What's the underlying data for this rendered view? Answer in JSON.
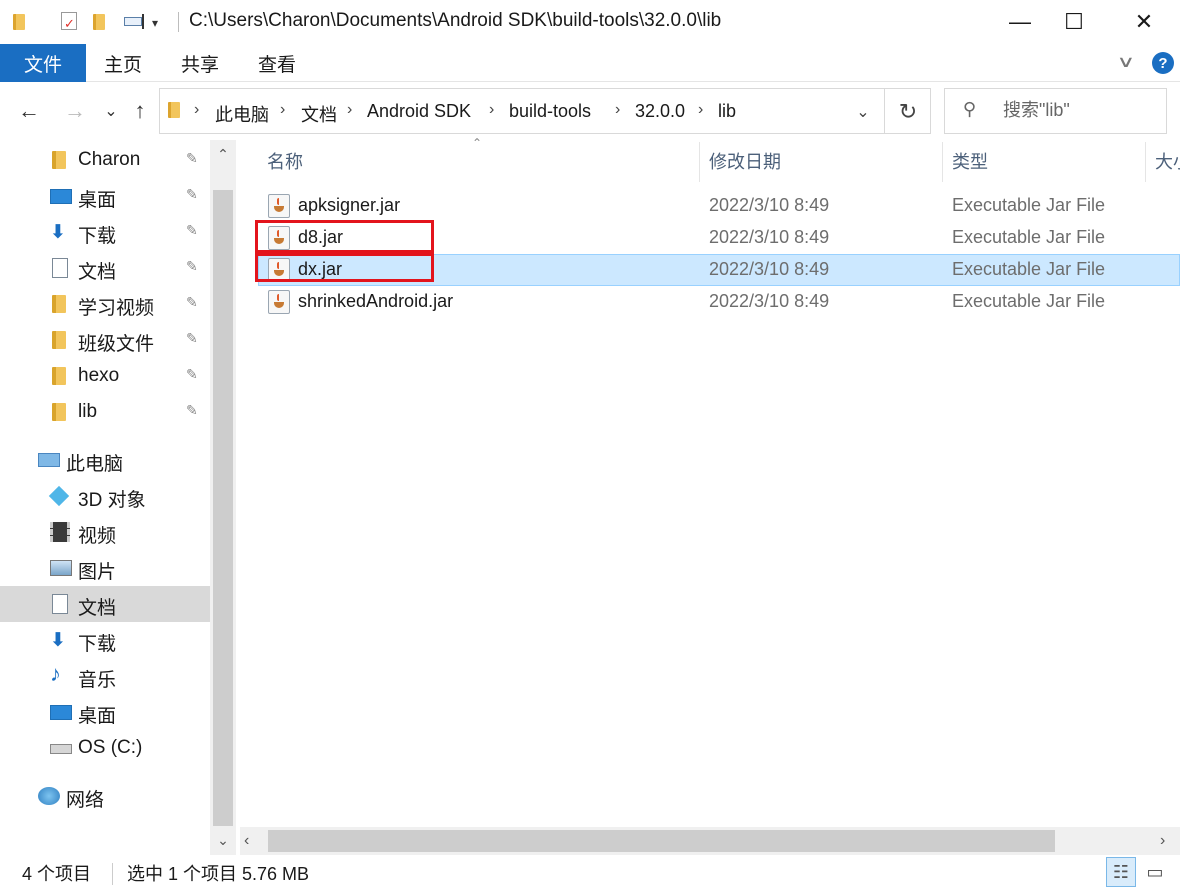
{
  "window": {
    "title_path": "C:\\Users\\Charon\\Documents\\Android SDK\\build-tools\\32.0.0\\lib",
    "minimize_glyph": "—",
    "maximize_glyph": "☐",
    "close_glyph": "✕"
  },
  "ribbon": {
    "tabs": [
      "文件",
      "主页",
      "共享",
      "查看"
    ],
    "help_glyph": "?"
  },
  "nav": {
    "back_glyph": "←",
    "forward_glyph": "→",
    "recent_glyph": "⌄",
    "up_glyph": "↑",
    "breadcrumbs": [
      "此电脑",
      "文档",
      "Android SDK",
      "build-tools",
      "32.0.0",
      "lib"
    ],
    "separator": "›",
    "dropdown_glyph": "⌄",
    "refresh_glyph": "↻"
  },
  "search": {
    "placeholder": "搜索\"lib\"",
    "icon": "search-icon"
  },
  "sidebar": {
    "quick_access": [
      {
        "label": "Charon",
        "icon": "folder-icon",
        "pinned": true
      },
      {
        "label": "桌面",
        "icon": "desktop-icon",
        "pinned": true
      },
      {
        "label": "下载",
        "icon": "download-icon",
        "pinned": true
      },
      {
        "label": "文档",
        "icon": "documents-icon",
        "pinned": true
      },
      {
        "label": "学习视频",
        "icon": "folder-icon",
        "pinned": true
      },
      {
        "label": "班级文件",
        "icon": "folder-icon",
        "pinned": true
      },
      {
        "label": "hexo",
        "icon": "folder-icon",
        "pinned": true
      },
      {
        "label": "lib",
        "icon": "folder-icon",
        "pinned": true
      }
    ],
    "this_pc": "此电脑",
    "pc_items": [
      {
        "label": "3D 对象",
        "icon": "3d-objects-icon"
      },
      {
        "label": "视频",
        "icon": "videos-icon"
      },
      {
        "label": "图片",
        "icon": "pictures-icon"
      },
      {
        "label": "文档",
        "icon": "documents-icon",
        "selected": true
      },
      {
        "label": "下载",
        "icon": "download-icon"
      },
      {
        "label": "音乐",
        "icon": "music-icon"
      },
      {
        "label": "桌面",
        "icon": "desktop-icon"
      },
      {
        "label": "OS (C:)",
        "icon": "drive-icon"
      }
    ],
    "network": "网络",
    "pin_glyph": "📌"
  },
  "columns": [
    "名称",
    "修改日期",
    "类型",
    "大小"
  ],
  "files": [
    {
      "name": "apksigner.jar",
      "modified": "2022/3/10 8:49",
      "type": "Executable Jar File",
      "selected": false,
      "highlighted": false
    },
    {
      "name": "d8.jar",
      "modified": "2022/3/10 8:49",
      "type": "Executable Jar File",
      "selected": false,
      "highlighted": true
    },
    {
      "name": "dx.jar",
      "modified": "2022/3/10 8:49",
      "type": "Executable Jar File",
      "selected": true,
      "highlighted": true
    },
    {
      "name": "shrinkedAndroid.jar",
      "modified": "2022/3/10 8:49",
      "type": "Executable Jar File",
      "selected": false,
      "highlighted": false
    }
  ],
  "status": {
    "item_count": "4 个项目",
    "selection": "选中 1 个项目  5.76 MB"
  },
  "colors": {
    "accent": "#1a6ec2",
    "selection_bg": "#cce8ff",
    "highlight_border": "#e3141c"
  }
}
